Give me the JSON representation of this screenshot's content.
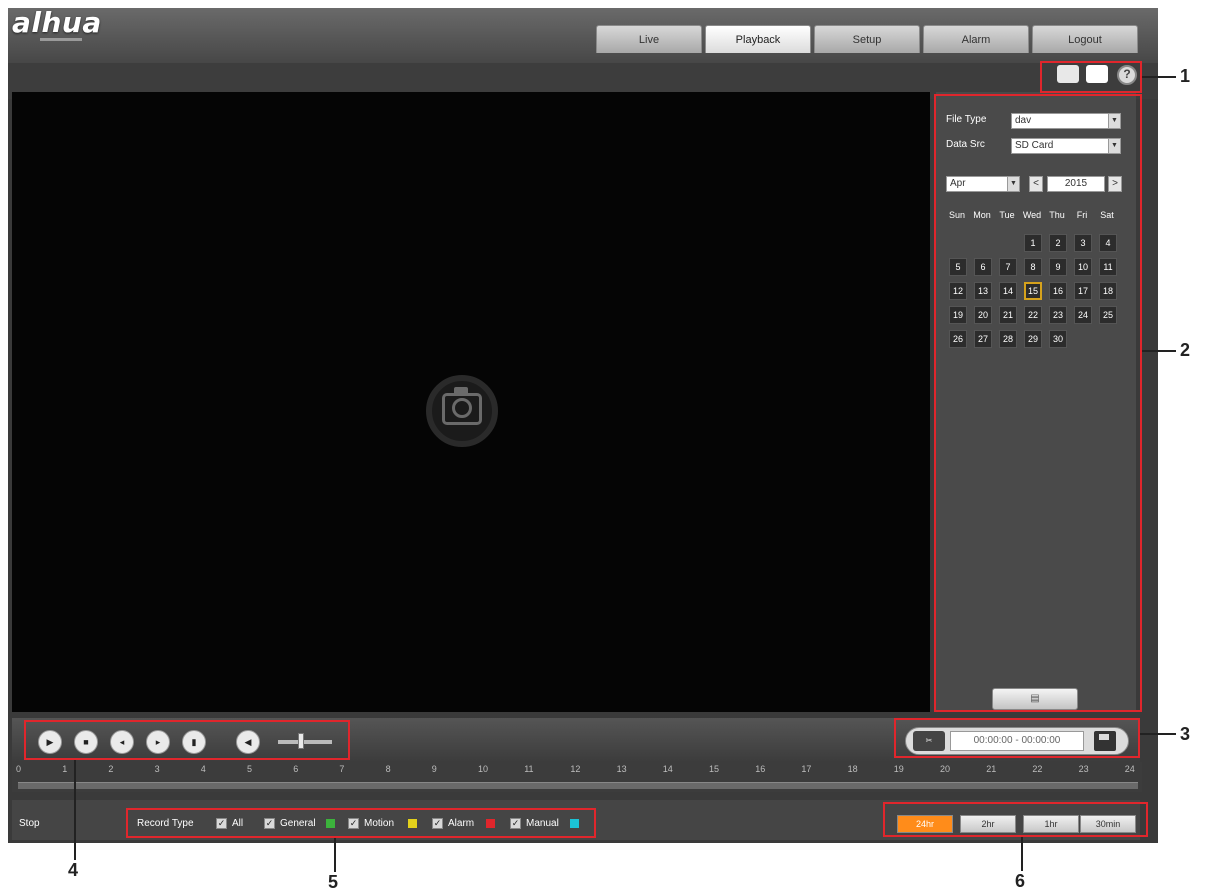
{
  "header": {
    "logo": "alhua",
    "tabs": [
      {
        "label": "Live"
      },
      {
        "label": "Playback"
      },
      {
        "label": "Setup"
      },
      {
        "label": "Alarm"
      },
      {
        "label": "Logout"
      }
    ]
  },
  "toolbar": {
    "help": "?"
  },
  "side": {
    "file_type_label": "File Type",
    "file_type_value": "dav",
    "data_src_label": "Data Src",
    "data_src_value": "SD Card",
    "month": "Apr",
    "year": "2015",
    "prev": "<",
    "next": ">",
    "weekdays": [
      "Sun",
      "Mon",
      "Tue",
      "Wed",
      "Thu",
      "Fri",
      "Sat"
    ],
    "days": [
      "1",
      "2",
      "3",
      "4",
      "5",
      "6",
      "7",
      "8",
      "9",
      "10",
      "11",
      "12",
      "13",
      "14",
      "15",
      "16",
      "17",
      "18",
      "19",
      "20",
      "21",
      "22",
      "23",
      "24",
      "25",
      "26",
      "27",
      "28",
      "29",
      "30"
    ],
    "today": "15"
  },
  "controls": {
    "time_range": "00:00:00 - 00:00:00"
  },
  "timeline": {
    "ticks": [
      "0",
      "1",
      "2",
      "3",
      "4",
      "5",
      "6",
      "7",
      "8",
      "9",
      "10",
      "11",
      "12",
      "13",
      "14",
      "15",
      "16",
      "17",
      "18",
      "19",
      "20",
      "21",
      "22",
      "23",
      "24"
    ]
  },
  "status": {
    "state": "Stop",
    "record_type_label": "Record Type",
    "types": [
      {
        "label": "All",
        "color": ""
      },
      {
        "label": "General",
        "color": "#3cb33c"
      },
      {
        "label": "Motion",
        "color": "#e3d11b"
      },
      {
        "label": "Alarm",
        "color": "#e0262c"
      },
      {
        "label": "Manual",
        "color": "#1bc2d6"
      }
    ],
    "zoom": [
      "24hr",
      "2hr",
      "1hr",
      "30min"
    ],
    "zoom_active": "24hr"
  },
  "annotations": [
    "1",
    "2",
    "3",
    "4",
    "5",
    "6"
  ]
}
